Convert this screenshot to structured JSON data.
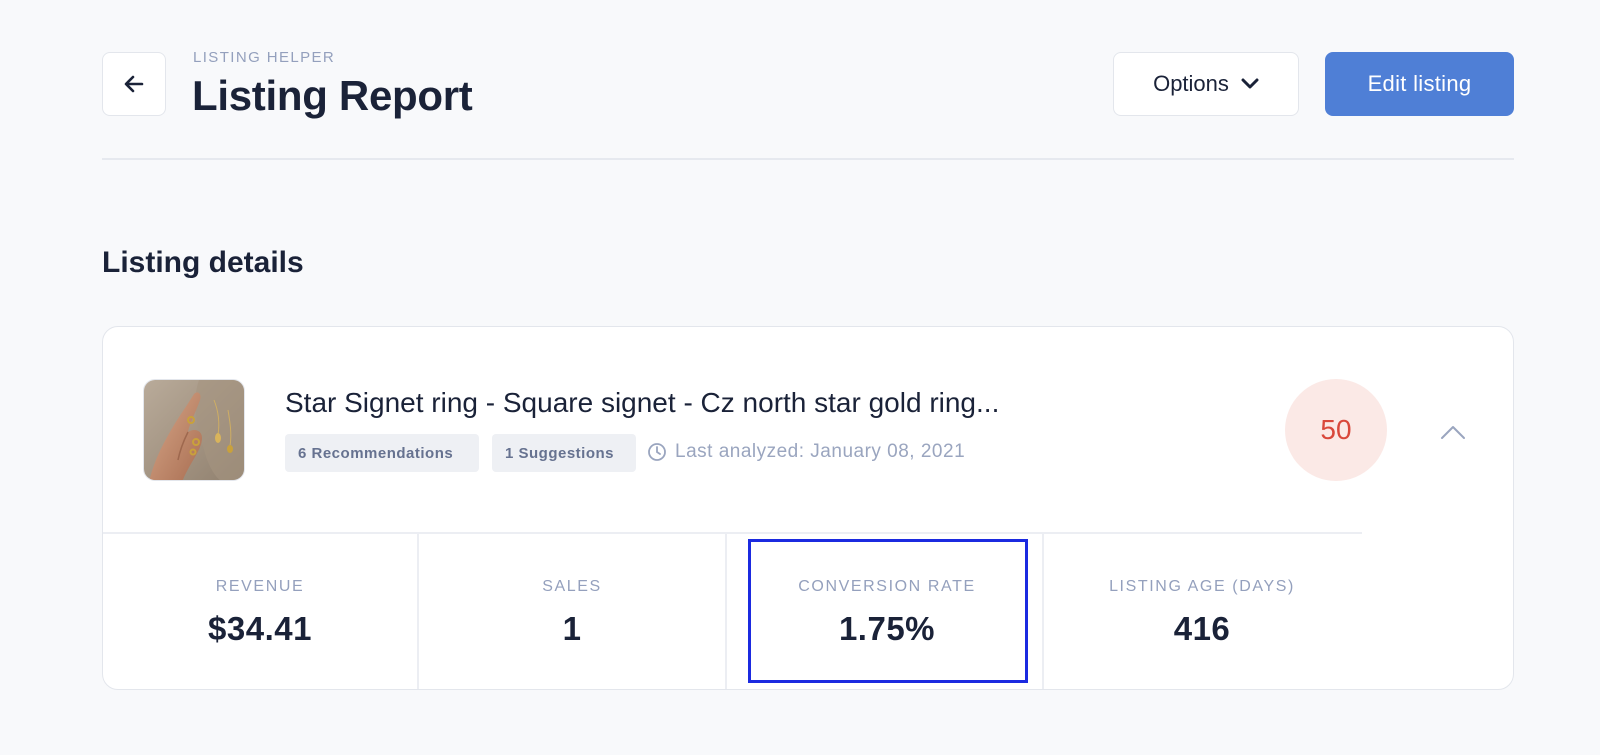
{
  "header": {
    "eyebrow": "LISTING HELPER",
    "title": "Listing Report",
    "options_label": "Options",
    "edit_label": "Edit listing"
  },
  "section": {
    "title": "Listing details"
  },
  "listing": {
    "name": "Star Signet ring - Square signet - Cz north star gold ring...",
    "recommendations": "6 Recommendations",
    "suggestions": "1 Suggestions",
    "last_analyzed": "Last analyzed: January 08, 2021",
    "score": "50"
  },
  "stats": [
    {
      "label": "REVENUE",
      "value": "$34.41"
    },
    {
      "label": "SALES",
      "value": "1"
    },
    {
      "label": "CONVERSION RATE",
      "value": "1.75%"
    },
    {
      "label": "LISTING AGE (DAYS)",
      "value": "416"
    }
  ],
  "colors": {
    "accent": "#4f7fd6",
    "score_bg": "#fbe9e6",
    "score_text": "#d9483b",
    "highlight_border": "#1b2ae0"
  },
  "icons": {
    "back": "arrow-left-icon",
    "options": "chevron-down-icon",
    "analyzed": "clock-icon",
    "collapse": "chevron-up-icon"
  }
}
